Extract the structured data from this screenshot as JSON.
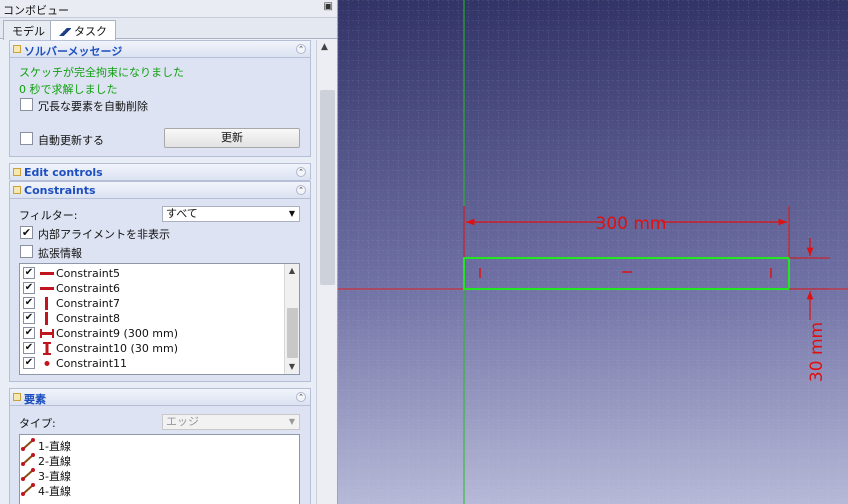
{
  "combo": {
    "title": "コンボビュー",
    "float_icon": "float-icon",
    "tabs": [
      {
        "label": "モデル"
      },
      {
        "label": "タスク",
        "icon": "task-icon"
      }
    ]
  },
  "solver": {
    "title": "ソルバーメッセージ",
    "status_line1": "スケッチが完全拘束になりました",
    "status_line2": "0 秒で求解しました",
    "auto_remove_label": "冗長な要素を自動削除",
    "auto_remove_checked": false,
    "auto_update_label": "自動更新する",
    "auto_update_checked": false,
    "update_button": "更新"
  },
  "edit_controls": {
    "title": "Edit controls"
  },
  "constraints": {
    "title": "Constraints",
    "filter_label": "フィルター:",
    "filter_value": "すべて",
    "hide_internal_label": "内部アライメントを非表示",
    "hide_internal_checked": true,
    "extended_label": "拡張情報",
    "extended_checked": false,
    "items": [
      {
        "label": "Constraint5",
        "checked": true,
        "icon": "horizontal-constraint-icon"
      },
      {
        "label": "Constraint6",
        "checked": true,
        "icon": "horizontal-constraint-icon"
      },
      {
        "label": "Constraint7",
        "checked": true,
        "icon": "vertical-constraint-icon"
      },
      {
        "label": "Constraint8",
        "checked": true,
        "icon": "vertical-constraint-icon"
      },
      {
        "label": "Constraint9 (300 mm)",
        "checked": true,
        "icon": "horizontal-distance-icon"
      },
      {
        "label": "Constraint10 (30 mm)",
        "checked": true,
        "icon": "vertical-distance-icon"
      },
      {
        "label": "Constraint11",
        "checked": true,
        "icon": "point-on-point-icon"
      }
    ]
  },
  "elements": {
    "title": "要素",
    "type_label": "タイプ:",
    "type_value": "エッジ",
    "items": [
      {
        "label": "1-直線",
        "icon": "line-icon"
      },
      {
        "label": "2-直線",
        "icon": "line-icon"
      },
      {
        "label": "3-直線",
        "icon": "line-icon"
      },
      {
        "label": "4-直線",
        "icon": "line-icon"
      }
    ]
  },
  "viewport": {
    "dim_horizontal": "300 mm",
    "dim_vertical": "30 mm",
    "colors": {
      "axis_red": "#e02020",
      "axis_green": "#20c020",
      "sketch_green": "#22e622",
      "dimension_red": "#e01010"
    }
  }
}
